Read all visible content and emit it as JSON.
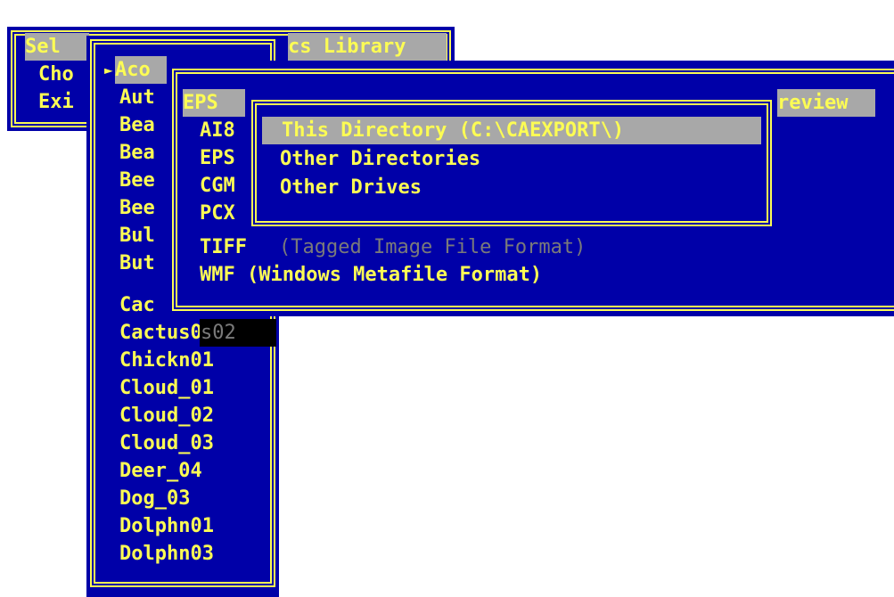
{
  "main_menu": {
    "title_left": "Sel",
    "title_right": "cs Library",
    "items": [
      "Cho",
      "Exi"
    ]
  },
  "file_list": {
    "pointer": "►",
    "items": [
      "Aco",
      "Aut",
      "Bea",
      "Bea",
      "Bee",
      "Bee",
      "Bul",
      "But",
      "Cac",
      "Cactus02",
      "Chickn01",
      "Cloud_01",
      "Cloud_02",
      "Cloud_03",
      "Deer_04",
      "Dog_03",
      "Dolphn01",
      "Dolphn03"
    ],
    "behind_text": "s02"
  },
  "format_menu": {
    "title_suffix": "review",
    "items": [
      "EPS",
      "AI8",
      "EPS",
      "CGM",
      "PCX",
      "TIFF",
      "WMF (Windows Metafile Format)"
    ],
    "tiff_desc": "(Tagged Image File Format)"
  },
  "directory_menu": {
    "items": [
      "This Directory (C:\\CAEXPORT\\)",
      "Other Directories",
      "Other Drives"
    ]
  },
  "colors": {
    "background": "#0000a8",
    "text": "#fcfc54",
    "highlight": "#a8a8a8",
    "shadow": "#000000"
  }
}
